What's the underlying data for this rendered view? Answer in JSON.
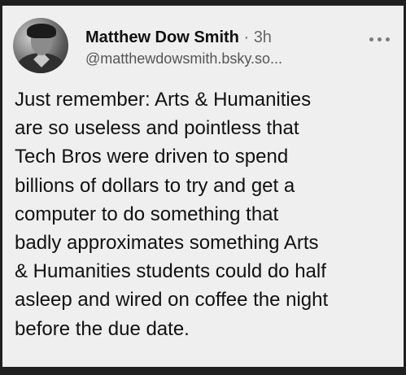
{
  "post": {
    "author": {
      "display_name": "Matthew Dow Smith",
      "separator": "·",
      "time": "3h",
      "handle": "@matthewdowsmith.bsky.so..."
    },
    "text": "Just remember: Arts & Humanities\nare so useless and pointless that\nTech Bros were driven to spend\nbillions of dollars to try and get a\ncomputer to do something that\nbadly approximates something Arts\n& Humanities students could do half\nasleep and wired on coffee the night\nbefore the due date.",
    "more_icon": "more-horizontal-icon"
  },
  "colors": {
    "background": "#202020",
    "card": "#efefef",
    "text": "#111111",
    "muted": "#666666"
  }
}
